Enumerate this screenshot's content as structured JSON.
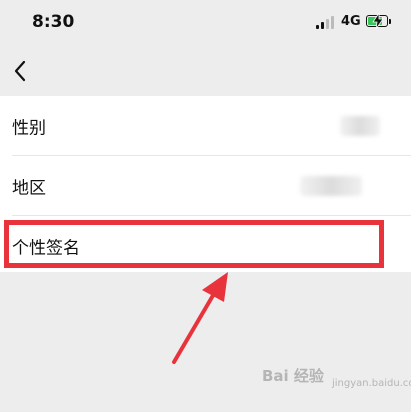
{
  "status_bar": {
    "time": "8:30",
    "network": "4G"
  },
  "nav": {
    "back_icon": "chevron-left-icon"
  },
  "rows": [
    {
      "label": "性别"
    },
    {
      "label": "地区"
    },
    {
      "label": "个性签名"
    }
  ],
  "highlight_color": "#e8333d",
  "watermark": {
    "main": "Bai 经验",
    "sub": "jingyan.baidu.com"
  }
}
